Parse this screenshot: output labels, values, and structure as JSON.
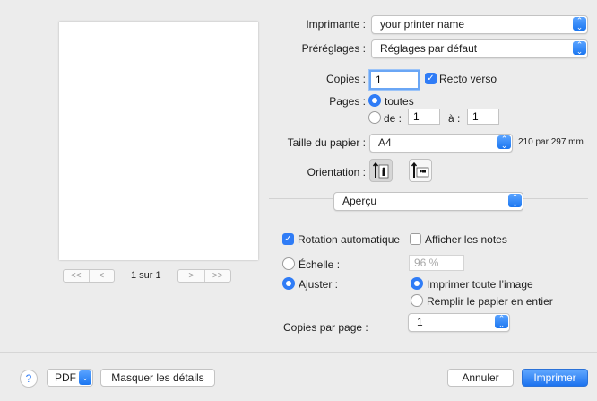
{
  "preview": {
    "nav_left": [
      "<<",
      "<"
    ],
    "nav_right": [
      ">",
      ">>"
    ],
    "page_indicator": "1 sur 1"
  },
  "printer": {
    "label": "Imprimante :",
    "value": "your printer name"
  },
  "presets": {
    "label": "Préréglages :",
    "value": "Réglages par défaut"
  },
  "copies": {
    "label": "Copies :",
    "value": "1",
    "duplex_label": "Recto verso",
    "duplex_checked": true
  },
  "pages": {
    "label": "Pages :",
    "all_label": "toutes",
    "from_label": "de :",
    "from_value": "1",
    "to_label": "à :",
    "to_value": "1",
    "selected": "toutes"
  },
  "paper": {
    "label": "Taille du papier :",
    "value": "A4",
    "dimensions": "210 par 297 mm"
  },
  "orientation": {
    "label": "Orientation :",
    "selected": "portrait"
  },
  "section_popup": {
    "value": "Aperçu"
  },
  "options": {
    "auto_rotate_label": "Rotation automatique",
    "auto_rotate_checked": true,
    "show_notes_label": "Afficher les notes",
    "show_notes_checked": false,
    "scale_label": "Échelle :",
    "scale_value": "96 %",
    "fit_label": "Ajuster :",
    "fit_selected": true,
    "print_entire_label": "Imprimer toute l’image",
    "fill_paper_label": "Remplir le papier en entier",
    "fit_mode": "Imprimer toute l’image"
  },
  "copies_per_page": {
    "label": "Copies par page :",
    "value": "1"
  },
  "footer": {
    "help": "?",
    "pdf_label": "PDF",
    "hide_details_label": "Masquer les détails",
    "cancel_label": "Annuler",
    "print_label": "Imprimer"
  },
  "colors": {
    "accent": "#2f7cf6",
    "background": "#ececec"
  },
  "icons": {
    "popup_chevron": "up-down-chevron-icon",
    "checkbox": "checkmark-icon",
    "portrait": "portrait-orientation-icon",
    "landscape": "landscape-orientation-icon",
    "help": "question-icon"
  }
}
